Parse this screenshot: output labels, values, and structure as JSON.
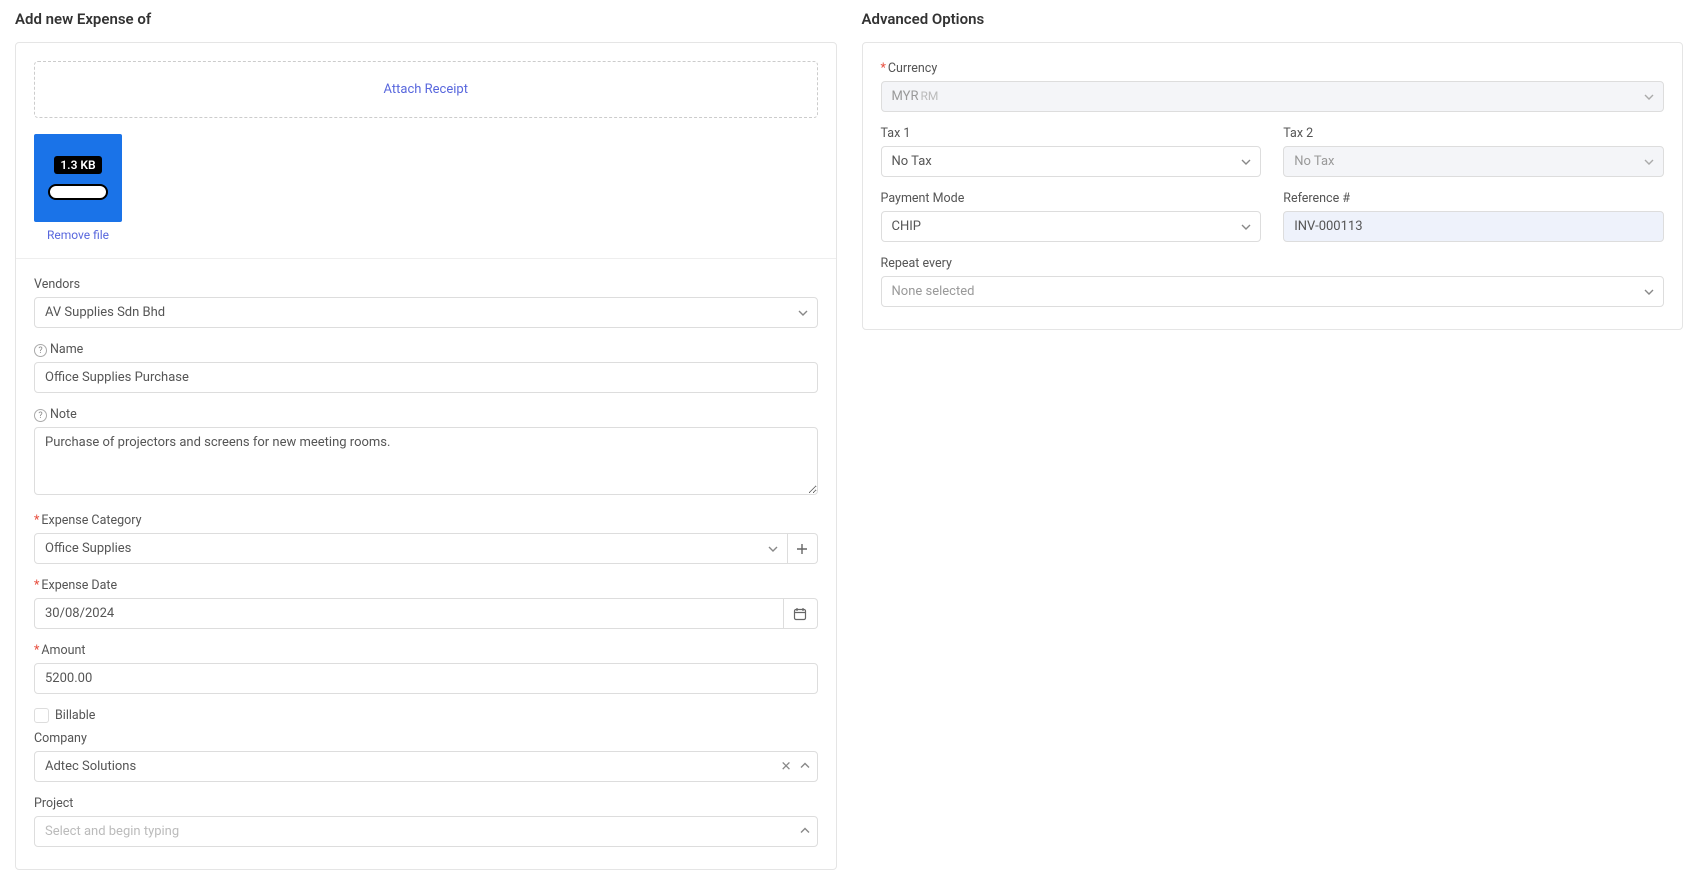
{
  "left": {
    "title": "Add new Expense of",
    "attach_label": "Attach Receipt",
    "file_size": "1.3 KB",
    "remove_file": "Remove file",
    "vendors_label": "Vendors",
    "vendors_value": "AV Supplies Sdn Bhd",
    "name_label": "Name",
    "name_value": "Office Supplies Purchase",
    "note_label": "Note",
    "note_value": "Purchase of projectors and screens for new meeting rooms.",
    "category_label": "Expense Category",
    "category_value": "Office Supplies",
    "date_label": "Expense Date",
    "date_value": "30/08/2024",
    "amount_label": "Amount",
    "amount_value": "5200.00",
    "billable_label": "Billable",
    "company_label": "Company",
    "company_value": "Adtec Solutions",
    "project_label": "Project",
    "project_placeholder": "Select and begin typing"
  },
  "right": {
    "title": "Advanced Options",
    "currency_label": "Currency",
    "currency_value": "MYR",
    "currency_suffix": "RM",
    "tax1_label": "Tax 1",
    "tax1_value": "No Tax",
    "tax2_label": "Tax 2",
    "tax2_value": "No Tax",
    "payment_mode_label": "Payment Mode",
    "payment_mode_value": "CHIP",
    "reference_label": "Reference #",
    "reference_value": "INV-000113",
    "repeat_label": "Repeat every",
    "repeat_value": "None selected"
  }
}
